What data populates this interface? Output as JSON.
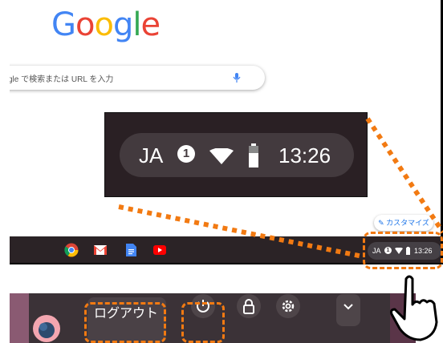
{
  "browser": {
    "logo": [
      {
        "ch": "G",
        "color": "#4285F4"
      },
      {
        "ch": "o",
        "color": "#EA4335"
      },
      {
        "ch": "o",
        "color": "#FBBC05"
      },
      {
        "ch": "g",
        "color": "#4285F4"
      },
      {
        "ch": "l",
        "color": "#34A853"
      },
      {
        "ch": "e",
        "color": "#EA4335"
      }
    ],
    "search_placeholder": "gle で検索または URL を入力",
    "customize_label": "カスタマイズ"
  },
  "zoom": {
    "lang": "JA",
    "notification_count": "1",
    "time": "13:26"
  },
  "shelf": {
    "apps": [
      "chrome-icon",
      "gmail-icon",
      "docs-icon",
      "youtube-icon"
    ],
    "tray": {
      "lang": "JA",
      "notification_count": "1",
      "time": "13:26"
    }
  },
  "menu": {
    "logout_label": "ログアウト",
    "buttons": [
      "power-icon",
      "lock-icon",
      "settings-icon",
      "chevron-down-icon"
    ]
  },
  "colors": {
    "highlight": "#f27a12"
  }
}
